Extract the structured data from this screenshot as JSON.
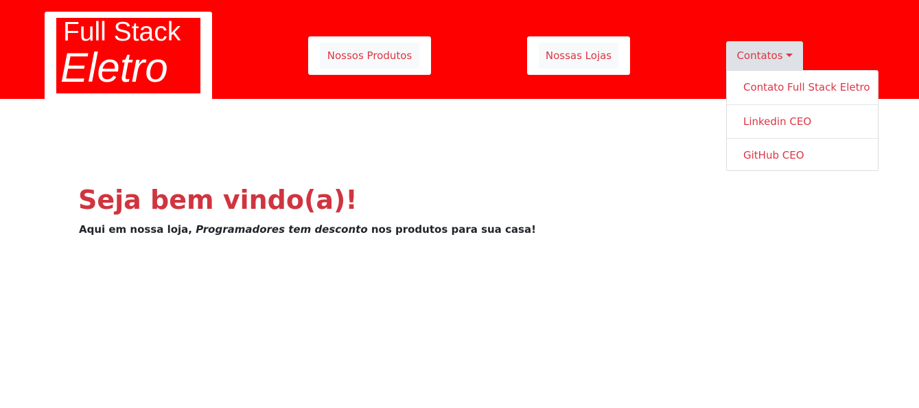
{
  "logo": {
    "line1": "Full Stack",
    "line2": "Eletro"
  },
  "nav": {
    "produtos_label": "Nossos Produtos",
    "lojas_label": "Nossas Lojas",
    "contatos_label": "Contatos",
    "contatos_menu": [
      "Contato Full Stack Eletro",
      "Linkedin CEO",
      "GitHub CEO"
    ]
  },
  "hero": {
    "title": "Seja bem vindo(a)!",
    "text_before": "Aqui em nossa loja, ",
    "text_emphasis": "Programadores tem desconto",
    "text_after": " nos produtos para sua casa!"
  },
  "colors": {
    "header_background": "#ff0000",
    "accent": "#dc3545",
    "button_background": "#f8f9fa",
    "toggle_background": "#dee2e6",
    "body_text": "#212529"
  },
  "icons": {
    "dropdown_caret": "caret-down-icon"
  }
}
